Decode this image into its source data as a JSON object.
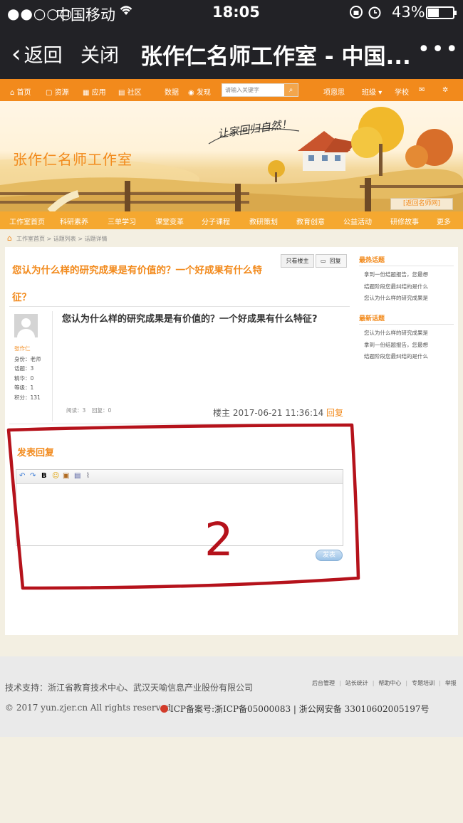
{
  "status_bar": {
    "signal": "●●○○○",
    "carrier": "中国移动",
    "time": "18:05",
    "battery": "43%"
  },
  "nav": {
    "back_label": "返回",
    "close_label": "关闭",
    "title": "张作仁名师工作室 - 中国...",
    "more_icon": "more-icon"
  },
  "topbar": {
    "home": "首页",
    "resources": "资源",
    "apps": "应用",
    "community": "社区",
    "data": "数据",
    "discover": "发现",
    "search_placeholder": "请输入关键字",
    "user": "项恩思",
    "class": "班级",
    "school": "学校"
  },
  "banner": {
    "studio_name": "张作仁名师工作室",
    "slogan": "让家回归自然！",
    "return_link": "[返回名师网]"
  },
  "menu": [
    "工作室首页",
    "科研素养",
    "三单学习",
    "课堂变革",
    "分子课程",
    "教研策划",
    "教育创意",
    "公益活动",
    "研修故事",
    "更多"
  ],
  "breadcrumb": "工作室首页 > 话题列表 > 话题详情",
  "topic": {
    "title": "您认为什么样的研究成果是有价值的？一个好成果有什么特征？",
    "only_author_button": "只看楼主",
    "reply_button": "回复"
  },
  "post": {
    "author": "张作仁",
    "stats": [
      "身份：老师",
      "话题：3",
      "精华：0",
      "等级：1",
      "积分：131"
    ],
    "content": "您认为什么样的研究成果是有价值的？一个好成果有什么特征?",
    "reads": "阅读：3",
    "replies": "回复：0",
    "time": "楼主 2017-06-21 11:36:14",
    "reply_link": "回复"
  },
  "reply_form": {
    "heading": "发表回复",
    "submit_label": "发表",
    "annotation": "2"
  },
  "sidebar": {
    "hot_heading": "最热话题",
    "hot_items": [
      "拿到一份结题报告，您最想",
      "结题阶段您最纠结的是什么",
      "您认为什么样的研究成果是"
    ],
    "new_heading": "最新话题",
    "new_items": [
      "您认为什么样的研究成果是",
      "拿到一份结题报告，您最想",
      "结题阶段您最纠结的是什么"
    ]
  },
  "footer": {
    "support": "技术支持：浙江省教育技术中心、武汉天喻信息产业股份有限公司",
    "links": [
      "后台管理",
      "站长统计",
      "帮助中心",
      "专题培训",
      "举报"
    ],
    "copyright": "© 2017 yun.zjer.cn All rights reserved",
    "icp": "ICP备案号:浙ICP备05000083 | 浙公网安备 33010602005197号"
  },
  "colors": {
    "accent_orange": "#f28a1c",
    "menu_orange": "#f5a830",
    "annotation_red": "#b5121b"
  }
}
